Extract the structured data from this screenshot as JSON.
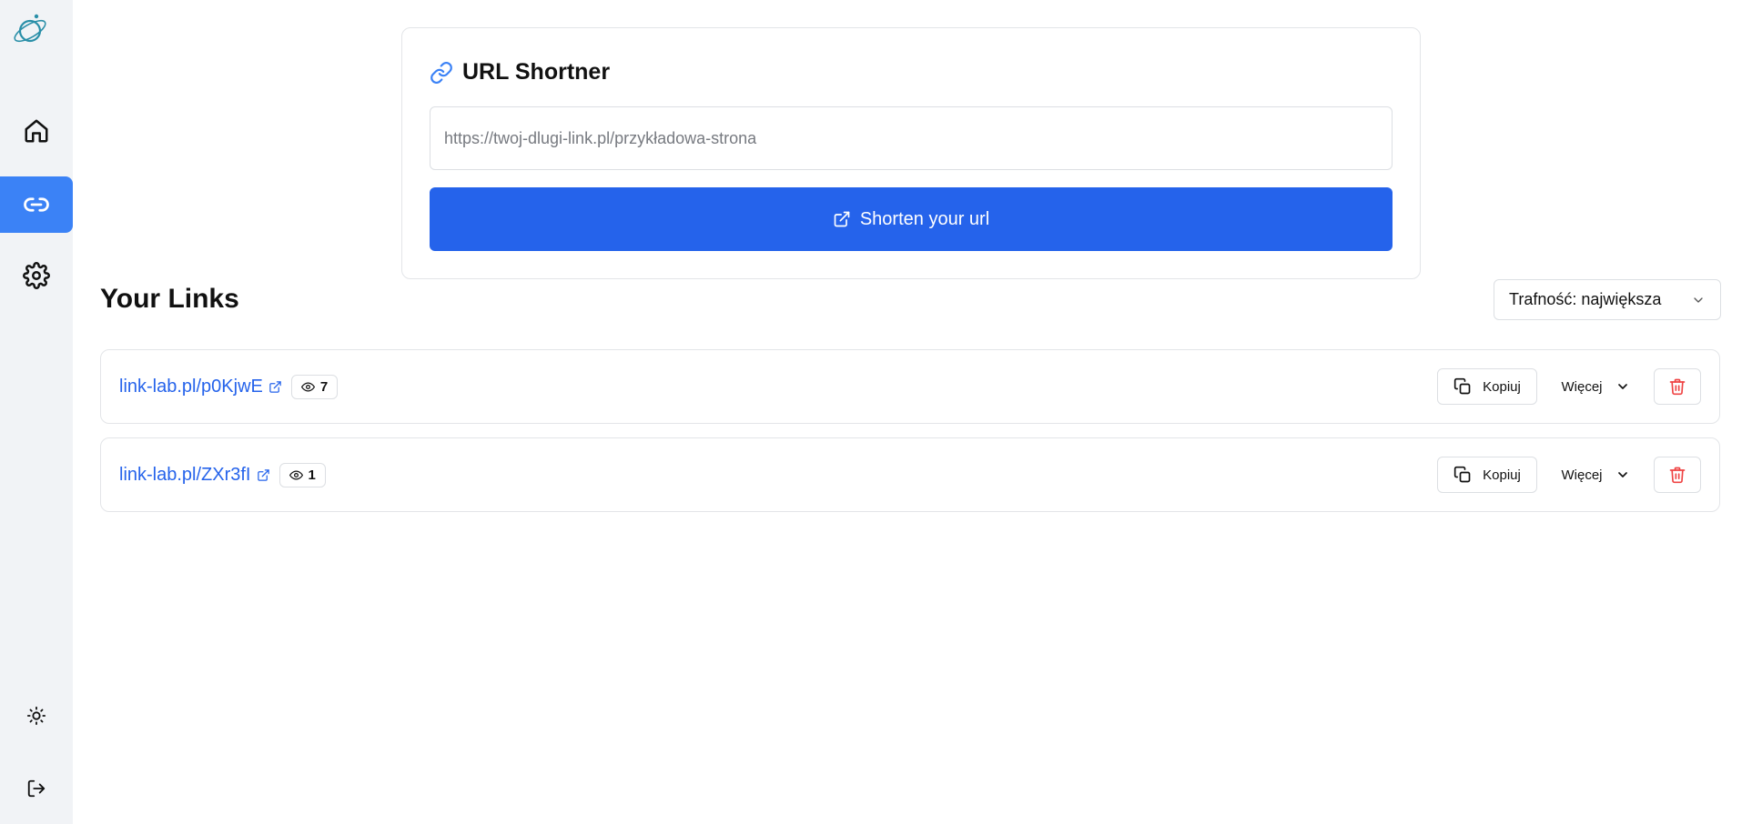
{
  "sidebar": {
    "logo_icon": "planet-logo-icon",
    "items": [
      {
        "icon": "home-icon",
        "active": false
      },
      {
        "icon": "link-icon",
        "active": true
      },
      {
        "icon": "gear-icon",
        "active": false
      }
    ],
    "bottom": [
      {
        "icon": "sun-icon"
      },
      {
        "icon": "logout-icon"
      }
    ]
  },
  "shortener": {
    "title": "URL Shortner",
    "title_icon": "link-icon",
    "input_value": "",
    "input_placeholder": "https://twoj-dlugi-link.pl/przykładowa-strona",
    "button_label": "Shorten your url",
    "button_icon": "external-link-icon"
  },
  "links_section": {
    "title": "Your Links",
    "sort_label": "Trafność: największa"
  },
  "links": [
    {
      "url": "link-lab.pl/p0KjwE",
      "views": "7",
      "copy_label": "Kopiuj",
      "more_label": "Więcej"
    },
    {
      "url": "link-lab.pl/ZXr3fI",
      "views": "1",
      "copy_label": "Kopiuj",
      "more_label": "Więcej"
    }
  ],
  "colors": {
    "accent": "#2563eb",
    "active_nav": "#3b82f6",
    "danger": "#ef4444",
    "sidebar_bg": "#f1f3f6"
  }
}
